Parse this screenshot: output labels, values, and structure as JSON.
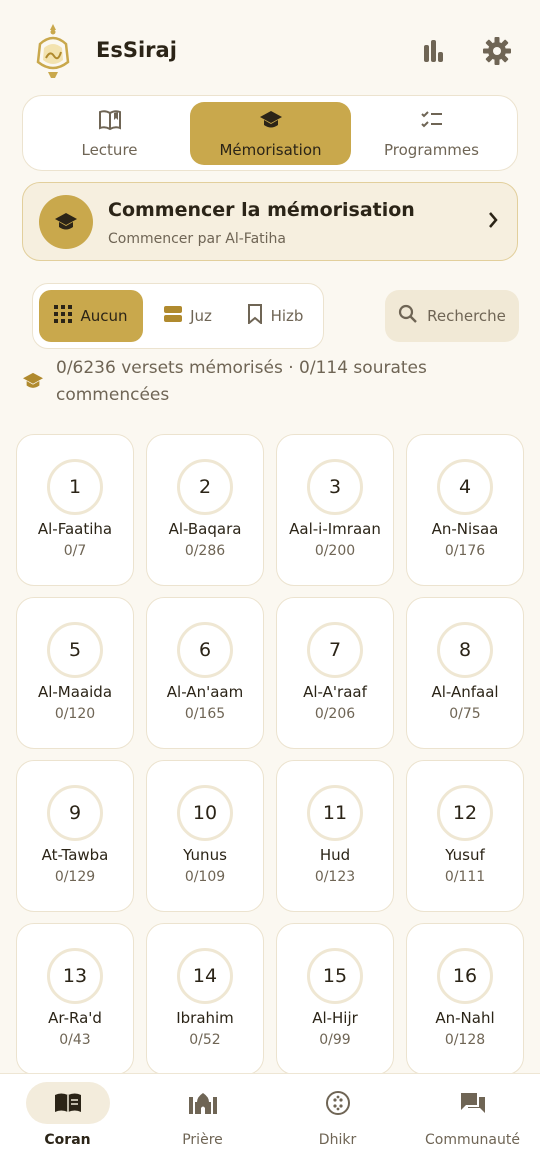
{
  "app": {
    "title": "EsSiraj",
    "logo_name": "essiraj-lantern-logo"
  },
  "mode_tabs": [
    {
      "label": "Lecture",
      "icon": "open-book-icon",
      "active": false
    },
    {
      "label": "Mémorisation",
      "icon": "graduation-cap-icon",
      "active": true
    },
    {
      "label": "Programmes",
      "icon": "checklist-icon",
      "active": false
    }
  ],
  "start_card": {
    "title": "Commencer la mémorisation",
    "subtitle": "Commencer par Al-Fatiha",
    "icon": "graduation-cap-icon"
  },
  "filters": [
    {
      "label": "Aucun",
      "icon": "grid-icon",
      "active": true
    },
    {
      "label": "Juz",
      "icon": "juz-icon",
      "active": false
    },
    {
      "label": "Hizb",
      "icon": "bookmark-icon",
      "active": false
    }
  ],
  "search": {
    "label": "Recherche",
    "icon": "search-icon"
  },
  "progress": {
    "text": "0/6236 versets mémorisés · 0/114 sourates commencées"
  },
  "surahs": [
    {
      "number": "1",
      "name": "Al-Faatiha",
      "progress": "0/7"
    },
    {
      "number": "2",
      "name": "Al-Baqara",
      "progress": "0/286"
    },
    {
      "number": "3",
      "name": "Aal-i-Imraan",
      "progress": "0/200"
    },
    {
      "number": "4",
      "name": "An-Nisaa",
      "progress": "0/176"
    },
    {
      "number": "5",
      "name": "Al-Maaida",
      "progress": "0/120"
    },
    {
      "number": "6",
      "name": "Al-An'aam",
      "progress": "0/165"
    },
    {
      "number": "7",
      "name": "Al-A'raaf",
      "progress": "0/206"
    },
    {
      "number": "8",
      "name": "Al-Anfaal",
      "progress": "0/75"
    },
    {
      "number": "9",
      "name": "At-Tawba",
      "progress": "0/129"
    },
    {
      "number": "10",
      "name": "Yunus",
      "progress": "0/109"
    },
    {
      "number": "11",
      "name": "Hud",
      "progress": "0/123"
    },
    {
      "number": "12",
      "name": "Yusuf",
      "progress": "0/111"
    },
    {
      "number": "13",
      "name": "Ar-Ra'd",
      "progress": "0/43"
    },
    {
      "number": "14",
      "name": "Ibrahim",
      "progress": "0/52"
    },
    {
      "number": "15",
      "name": "Al-Hijr",
      "progress": "0/99"
    },
    {
      "number": "16",
      "name": "An-Nahl",
      "progress": "0/128"
    }
  ],
  "bottom_nav": [
    {
      "label": "Coran",
      "icon": "quran-book-icon",
      "active": true
    },
    {
      "label": "Prière",
      "icon": "mosque-icon",
      "active": false
    },
    {
      "label": "Dhikr",
      "icon": "prayer-beads-icon",
      "active": false
    },
    {
      "label": "Communauté",
      "icon": "chat-bubbles-icon",
      "active": false
    }
  ],
  "colors": {
    "accent": "#c9a84c",
    "background": "#fbf8f1",
    "card": "#ffffff",
    "text": "#2b2417",
    "muted": "#6f6555"
  }
}
